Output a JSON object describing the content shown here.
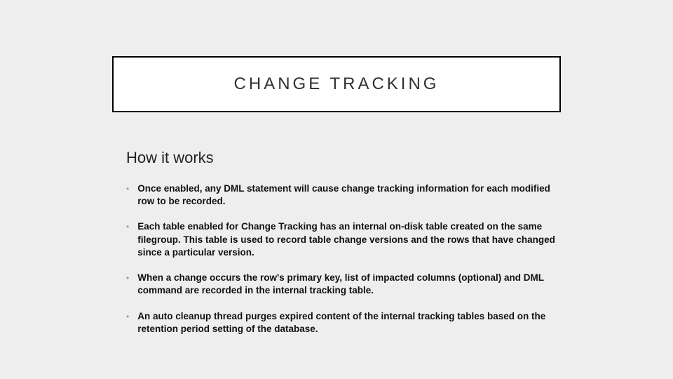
{
  "slide": {
    "title": "CHANGE TRACKING",
    "subtitle": "How it works",
    "bullets": [
      "Once enabled, any DML statement will cause change tracking information for each modified row to be recorded.",
      "Each table enabled for Change Tracking has an internal on-disk table created on the same filegroup.  This table is used to record table change versions and the rows that have changed since a particular version.",
      "When a change occurs the row's primary key, list of impacted columns (optional) and DML command are recorded in the internal tracking table.",
      "An auto cleanup thread purges expired content of the internal tracking tables based on the retention period setting of the database."
    ]
  }
}
